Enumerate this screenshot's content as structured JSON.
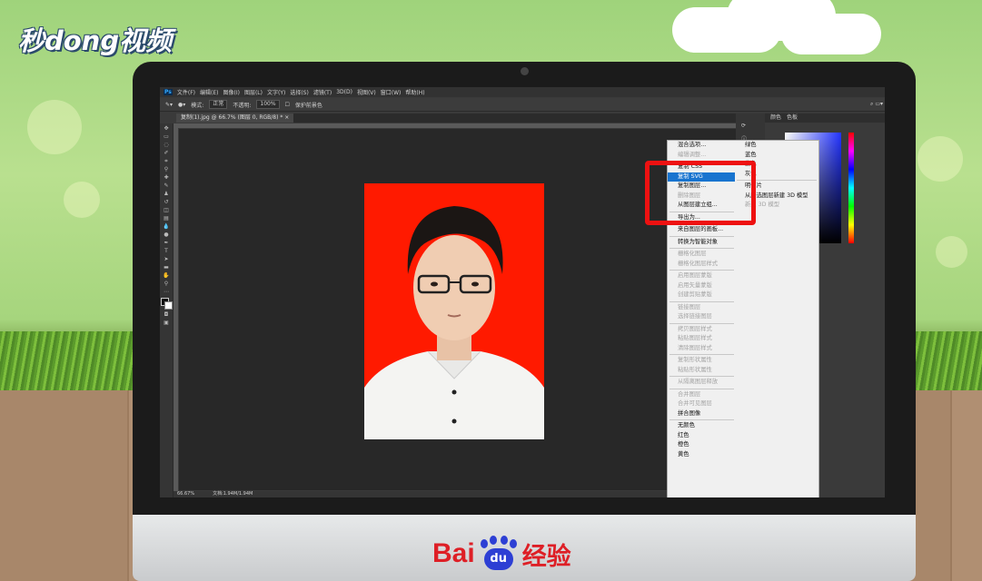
{
  "brand": {
    "watermark": "秒dong视频",
    "footer_bai": "Bai",
    "footer_du": "du",
    "footer_jy": "经验"
  },
  "menubar": [
    "Ps",
    "文件(F)",
    "编辑(E)",
    "图像(I)",
    "图层(L)",
    "文字(Y)",
    "选择(S)",
    "滤镜(T)",
    "3D(D)",
    "视图(V)",
    "窗口(W)",
    "帮助(H)"
  ],
  "options": {
    "mode_label": "模式:",
    "mode_value": "正常",
    "opacity_label": "不透明:",
    "opacity_value": "100%",
    "protect": "保护前景色"
  },
  "document_tab": "复制(1).jpg @ 66.7% (图层 0, RGB/8) *",
  "status": {
    "zoom": "66.67%",
    "doc": "文档:1.94M/1.94M"
  },
  "right_panel": {
    "tab1": "颜色",
    "tab2": "色板"
  },
  "context_menu_left": [
    {
      "label": "混合选项...",
      "state": "normal"
    },
    {
      "label": "编辑调整...",
      "state": "disabled"
    },
    {
      "sep": true
    },
    {
      "label": "复制 CSS",
      "state": "normal"
    },
    {
      "label": "复制 SVG",
      "state": "selected"
    },
    {
      "label": "复制图层...",
      "state": "normal"
    },
    {
      "label": "删除图层",
      "state": "disabled"
    },
    {
      "label": "从图层建立组...",
      "state": "normal"
    },
    {
      "sep": true
    },
    {
      "label": "导出为...",
      "state": "normal"
    },
    {
      "sep": true
    },
    {
      "label": "来自图层的画板...",
      "state": "normal"
    },
    {
      "sep": true
    },
    {
      "label": "转换为智能对象",
      "state": "normal"
    },
    {
      "sep": true
    },
    {
      "label": "栅格化图层",
      "state": "disabled"
    },
    {
      "label": "栅格化图层样式",
      "state": "disabled"
    },
    {
      "sep": true
    },
    {
      "label": "启用图层蒙版",
      "state": "disabled"
    },
    {
      "label": "启用矢量蒙版",
      "state": "disabled"
    },
    {
      "label": "创建剪贴蒙版",
      "state": "disabled"
    },
    {
      "sep": true
    },
    {
      "label": "链接图层",
      "state": "disabled"
    },
    {
      "label": "选择链接图层",
      "state": "disabled"
    },
    {
      "sep": true
    },
    {
      "label": "拷贝图层样式",
      "state": "disabled"
    },
    {
      "label": "粘贴图层样式",
      "state": "disabled"
    },
    {
      "label": "清除图层样式",
      "state": "disabled"
    },
    {
      "sep": true
    },
    {
      "label": "复制形状属性",
      "state": "disabled"
    },
    {
      "label": "粘贴形状属性",
      "state": "disabled"
    },
    {
      "sep": true
    },
    {
      "label": "从隔离图层释放",
      "state": "disabled"
    },
    {
      "sep": true
    },
    {
      "label": "合并图层",
      "state": "disabled"
    },
    {
      "label": "合并可见图层",
      "state": "disabled"
    },
    {
      "label": "拼合图像",
      "state": "normal"
    },
    {
      "sep": true
    },
    {
      "label": "无颜色",
      "state": "normal"
    },
    {
      "label": "红色",
      "state": "normal"
    },
    {
      "label": "橙色",
      "state": "normal"
    },
    {
      "label": "黄色",
      "state": "normal"
    }
  ],
  "context_menu_right": [
    {
      "label": "绿色",
      "state": "normal"
    },
    {
      "label": "蓝色",
      "state": "normal"
    },
    {
      "label": "紫色",
      "state": "normal"
    },
    {
      "label": "灰色",
      "state": "normal"
    },
    {
      "sep": true
    },
    {
      "label": "明信片",
      "state": "normal"
    },
    {
      "label": "从所选图层新建 3D 模型",
      "state": "normal"
    },
    {
      "label": "新建 3D 模型",
      "state": "disabled"
    }
  ]
}
